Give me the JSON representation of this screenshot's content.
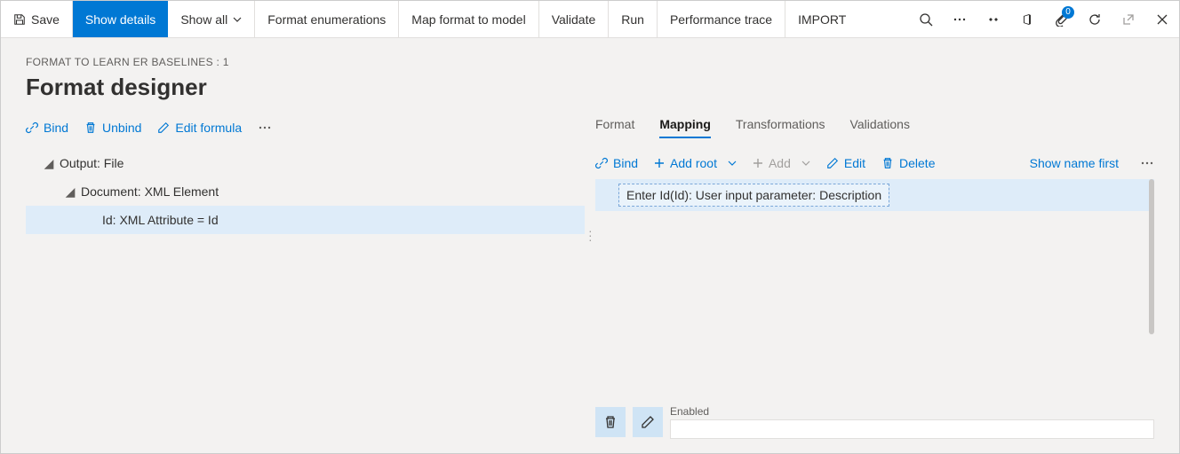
{
  "topbar": {
    "save": "Save",
    "show_details": "Show details",
    "show_all": "Show all",
    "format_enum": "Format enumerations",
    "map_format": "Map format to model",
    "validate": "Validate",
    "run": "Run",
    "perf_trace": "Performance trace",
    "import": "IMPORT",
    "badge_count": "0"
  },
  "breadcrumb": "FORMAT TO LEARN ER BASELINES : 1",
  "page_title": "Format designer",
  "left_actions": {
    "bind": "Bind",
    "unbind": "Unbind",
    "edit_formula": "Edit formula"
  },
  "tree": {
    "n1": "Output: File",
    "n2": "Document: XML Element",
    "n3": "Id: XML Attribute = Id"
  },
  "tabs": {
    "format": "Format",
    "mapping": "Mapping",
    "transformations": "Transformations",
    "validations": "Validations"
  },
  "right_actions": {
    "bind": "Bind",
    "add_root": "Add root",
    "add": "Add",
    "edit": "Edit",
    "delete": "Delete",
    "show_name_first": "Show name first"
  },
  "mapping_row": "Enter Id(Id): User input parameter: Description",
  "bottom": {
    "enabled_label": "Enabled"
  }
}
